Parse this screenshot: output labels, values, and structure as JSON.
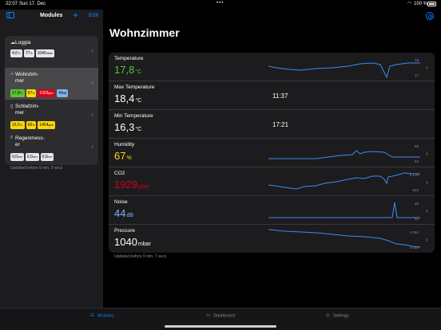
{
  "status_bar": {
    "time": "22:07",
    "date": "Sun 17. Dec",
    "battery": "100 %"
  },
  "sidebar": {
    "title": "Modules",
    "add_label": "+",
    "edit_label": "Edit",
    "modules": [
      {
        "name": "Loggia",
        "icon": "cloud-sun-icon",
        "chips": [
          {
            "v": "4,0",
            "u": "°C",
            "c": "gray"
          },
          {
            "v": "77",
            "u": "%",
            "c": "gray"
          },
          {
            "v": "1040",
            "u": "mbar",
            "c": "gray"
          }
        ]
      },
      {
        "name": "Wohnzim-\nmer",
        "icon": "house-icon",
        "chips": [
          {
            "v": "17,8",
            "u": "°C",
            "c": "green"
          },
          {
            "v": "67",
            "u": "%",
            "c": "yellow"
          },
          {
            "v": "1929",
            "u": "ppm",
            "c": "red"
          },
          {
            "v": "44",
            "u": "dB",
            "c": "blue"
          }
        ]
      },
      {
        "name": "Schlafzim-\nmer",
        "icon": "door-icon",
        "chips": [
          {
            "v": "16,5",
            "u": "°C",
            "c": "yellow"
          },
          {
            "v": "66",
            "u": "%",
            "c": "yellow"
          },
          {
            "v": "1454",
            "u": "ppm",
            "c": "yellow"
          }
        ]
      },
      {
        "name": "Regenmess-\ner",
        "icon": "raindrop-icon",
        "chips": [
          {
            "v": "0,0",
            "u": "mm",
            "c": "gray"
          },
          {
            "v": "0,0",
            "u": "mm",
            "c": "gray"
          },
          {
            "v": "0,0",
            "u": "mm",
            "c": "gray"
          }
        ]
      }
    ],
    "updated": "Updated before 9 min, 9 secs"
  },
  "main": {
    "title": "Wohnzimmer",
    "updated": "Updated before 9 min, 7 secs",
    "rows": [
      {
        "label": "Temperature",
        "value": "17,8",
        "unit": "°C",
        "color": "#5fc336",
        "spark": {
          "max": "18",
          "min": "17"
        }
      },
      {
        "label": "Max Temperature",
        "value": "18,4",
        "unit": "°C",
        "color": "#ffffff",
        "time": "11:37"
      },
      {
        "label": "Min Temperature",
        "value": "16,3",
        "unit": "°C",
        "color": "#ffffff",
        "time": "17:21"
      },
      {
        "label": "Humidity",
        "value": "67",
        "unit": "%",
        "color": "#ffd60a",
        "spark": {
          "max": "69",
          "min": "63"
        }
      },
      {
        "label": "CO2",
        "value": "1929",
        "unit": "ppm",
        "color": "#d70015",
        "spark": {
          "max": "2.176",
          "min": "614"
        }
      },
      {
        "label": "Noise",
        "value": "44",
        "unit": "dB",
        "color": "#7fb2f0",
        "spark": {
          "max": "45",
          "min": "44"
        }
      },
      {
        "label": "Pressure",
        "value": "1040",
        "unit": "mbar",
        "color": "#ffffff",
        "spark": {
          "max": "1.044",
          "min": "1.040"
        }
      }
    ]
  },
  "tabbar": {
    "tabs": [
      {
        "label": "Modules",
        "active": true
      },
      {
        "label": "Dashboard",
        "active": false
      },
      {
        "label": "Settings",
        "active": false
      }
    ]
  },
  "colors": {
    "accent": "#0a84ff",
    "spark_line": "#3a8cf5"
  }
}
